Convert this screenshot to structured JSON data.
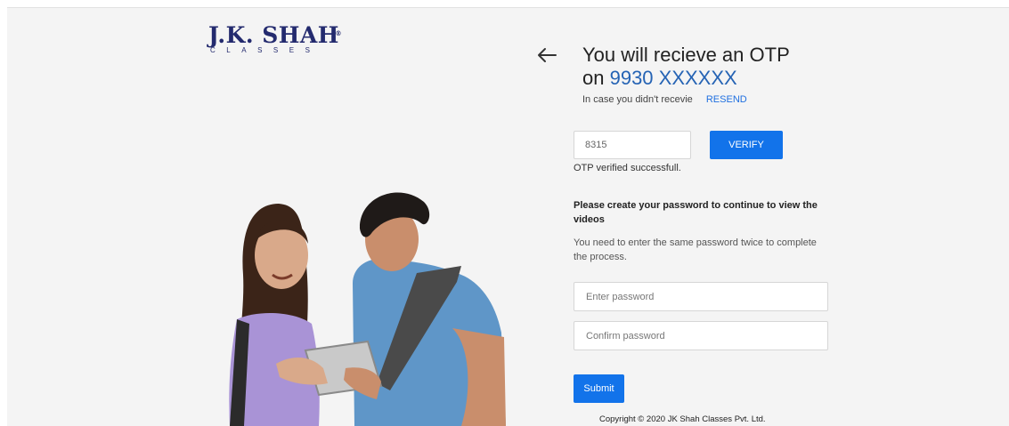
{
  "brand": {
    "name": "J.K. SHAH",
    "sub": "CLASSES",
    "reg_mark": "®",
    "colors": {
      "navy": "#232a6e",
      "accent": "#1273ea"
    }
  },
  "header": {
    "back_icon": "arrow-left-icon",
    "heading_line1": "You will recieve an OTP",
    "heading_on": "on ",
    "phone": "9930 XXXXXX"
  },
  "resend": {
    "text": "In case you didn't recevie",
    "link": "RESEND"
  },
  "otp": {
    "value": "8315",
    "verify_label": "VERIFY",
    "status": "OTP verified successfull."
  },
  "password_section": {
    "title": "Please create your password to continue to view the videos",
    "description": "You need to enter the same password twice to complete the process.",
    "password_placeholder": "Enter password",
    "confirm_placeholder": "Confirm password",
    "submit_label": "Submit"
  },
  "footer": {
    "copyright": "Copyright © 2020 JK Shah Classes Pvt. Ltd."
  }
}
